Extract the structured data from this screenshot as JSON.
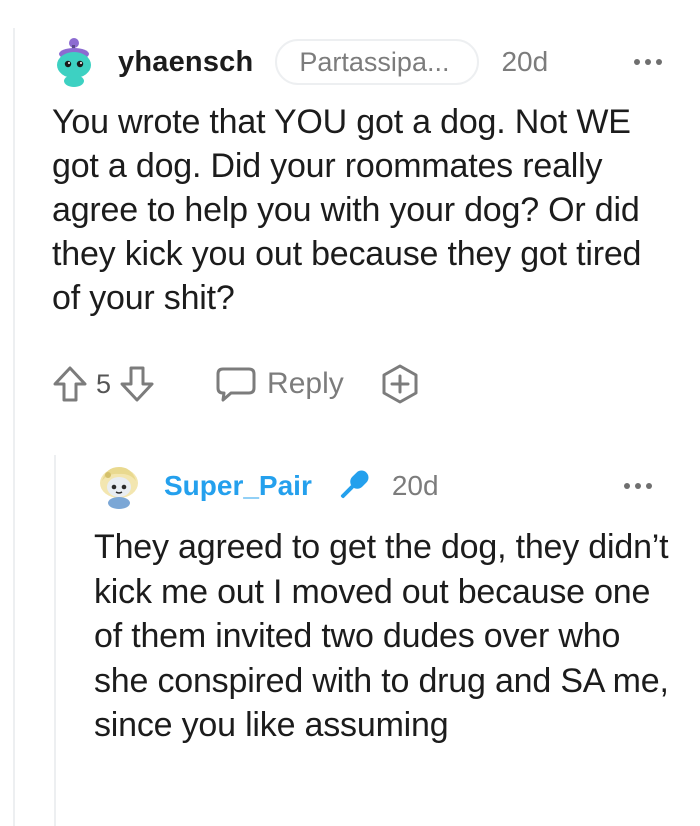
{
  "comment": {
    "username": "yhaensch",
    "flair": "Partassipa...",
    "timestamp": "20d",
    "body": "You wrote that YOU got a dog. Not WE got a dog. Did your roommates really agree to help you with your dog? Or did they kick you out because they got tired of your shit?",
    "score": "5",
    "reply_label": "Reply",
    "avatar_icon": "snoo-avatar-icon",
    "colors": {
      "avatar_body": "#3dd1c2",
      "avatar_hat": "#8c6bd1"
    }
  },
  "reply": {
    "username": "Super_Pair",
    "timestamp": "20d",
    "body": "They agreed to get the dog, they didn’t kick me out I moved out because one of them invited two dudes over who she conspired with to drug and SA me, since you like assuming",
    "badge_icon": "microphone-icon",
    "colors": {
      "username": "#24a0ed",
      "badge": "#24a0ed"
    }
  },
  "icons": {
    "upvote": "upvote-arrow-icon",
    "downvote": "downvote-arrow-icon",
    "reply": "chat-bubble-icon",
    "award": "award-plus-icon",
    "more": "more-options-icon"
  }
}
